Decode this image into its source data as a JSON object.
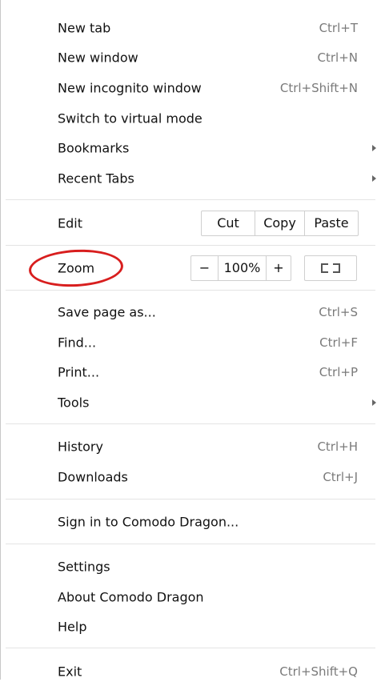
{
  "menu": {
    "items": [
      {
        "label": "New tab",
        "shortcut": "Ctrl+T"
      },
      {
        "label": "New window",
        "shortcut": "Ctrl+N"
      },
      {
        "label": "New incognito window",
        "shortcut": "Ctrl+Shift+N"
      },
      {
        "label": "Switch to virtual mode",
        "shortcut": ""
      },
      {
        "label": "Bookmarks",
        "shortcut": ""
      },
      {
        "label": "Recent Tabs",
        "shortcut": ""
      }
    ],
    "edit": {
      "label": "Edit",
      "cut": "Cut",
      "copy": "Copy",
      "paste": "Paste"
    },
    "zoom": {
      "label": "Zoom",
      "minus": "−",
      "value": "100%",
      "plus": "+",
      "fullscreen_icon": "fullscreen-icon",
      "highlight_color": "#d81e1e"
    },
    "page_items": [
      {
        "label": "Save page as...",
        "shortcut": "Ctrl+S"
      },
      {
        "label": "Find...",
        "shortcut": "Ctrl+F"
      },
      {
        "label": "Print...",
        "shortcut": "Ctrl+P"
      },
      {
        "label": "Tools",
        "shortcut": ""
      }
    ],
    "history_items": [
      {
        "label": "History",
        "shortcut": "Ctrl+H"
      },
      {
        "label": "Downloads",
        "shortcut": "Ctrl+J"
      }
    ],
    "signin": {
      "label": "Sign in to Comodo Dragon..."
    },
    "settings_items": [
      {
        "label": "Settings"
      },
      {
        "label": "About Comodo Dragon"
      },
      {
        "label": "Help"
      }
    ],
    "exit": {
      "label": "Exit",
      "shortcut": "Ctrl+Shift+Q"
    }
  }
}
